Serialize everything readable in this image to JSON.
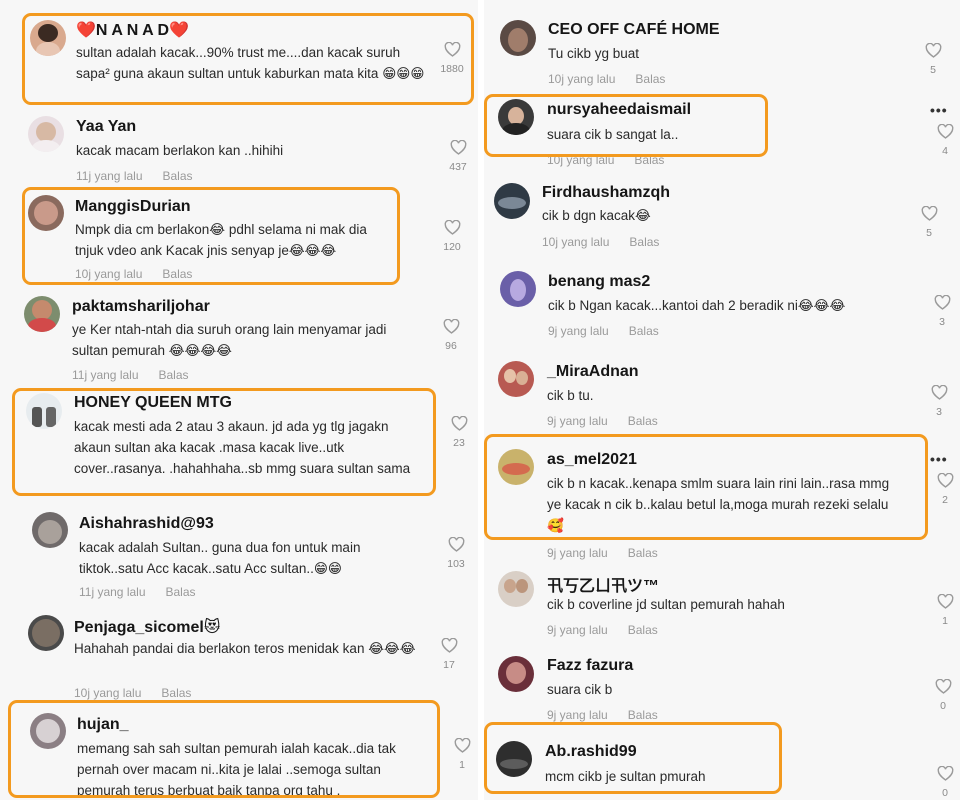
{
  "colors": {
    "highlight": "#f39a1f",
    "like_icon": "#9a9a9a"
  },
  "reply_label": "Balas",
  "more_label": "•••",
  "left_comments": [
    {
      "username": "❤️N A N A D❤️",
      "text": "sultan adalah kacak...90% trust me....dan kacak suruh sapa² guna akaun sultan untuk kaburkan mata kita 😁😁😁",
      "time": "",
      "likes": "1880",
      "highlighted": true
    },
    {
      "username": "Yaa Yan",
      "text": "kacak macam berlakon kan ..hihihi",
      "time": "11j yang lalu",
      "likes": "437",
      "highlighted": false
    },
    {
      "username": "ManggisDurian",
      "text": "Nmpk dia cm berlakon😂 pdhl selama ni mak dia tnjuk vdeo ank Kacak jnis senyap je😂😂😂",
      "time": "10j yang lalu",
      "likes": "120",
      "highlighted": true
    },
    {
      "username": "paktamshariljohar",
      "text": "ye Ker ntah-ntah dia suruh orang lain menyamar jadi sultan pemurah 😂😂😂😂",
      "time": "11j yang lalu",
      "likes": "96",
      "highlighted": false
    },
    {
      "username": "HONEY QUEEN MTG",
      "text": "kacak mesti ada 2 atau 3 akaun. jd ada yg tlg jagakn akaun sultan aka kacak .masa kacak live..utk cover..rasanya. .hahahhaha..sb mmg suara sultan sama",
      "time": "",
      "likes": "23",
      "highlighted": true
    },
    {
      "username": "Aishahrashid@93",
      "text": "kacak adalah Sultan.. guna dua fon untuk main tiktok..satu Acc kacak..satu Acc sultan..😁😁",
      "time": "11j yang lalu",
      "likes": "103",
      "highlighted": false
    },
    {
      "username": "Penjaga_sicomel😻",
      "text": "Hahahah pandai dia berlakon teros menidak kan 😂😂😂",
      "time": "10j yang lalu",
      "likes": "17",
      "highlighted": false
    },
    {
      "username": "hujan_",
      "text": "memang sah sah sultan pemurah ialah kacak..dia tak pernah over macam ni..kita je lalai ..semoga sultan pemurah terus berbuat baik tanpa org tahu .",
      "time": "",
      "likes": "1",
      "highlighted": true
    }
  ],
  "right_comments": [
    {
      "username": "CEO OFF CAFÉ HOME",
      "text": "Tu cikb yg buat",
      "time": "10j yang lalu",
      "likes": "5",
      "highlighted": false,
      "more": false
    },
    {
      "username": "nursyaheedaismail",
      "text": "suara cik b sangat la..",
      "time": "10j yang lalu",
      "likes": "4",
      "highlighted": true,
      "more": true
    },
    {
      "username": "Firdhaushamzqh",
      "text": "cik b dgn kacak😂",
      "time": "10j yang lalu",
      "likes": "5",
      "highlighted": false,
      "more": false
    },
    {
      "username": "benang mas2",
      "text": "cik b Ngan kacak...kantoi dah 2 beradik ni😂😂😂",
      "time": "9j yang lalu",
      "likes": "3",
      "highlighted": false,
      "more": false
    },
    {
      "username": "_MiraAdnan",
      "text": "cik b tu.",
      "time": "9j yang lalu",
      "likes": "3",
      "highlighted": false,
      "more": false
    },
    {
      "username": "as_mel2021",
      "text": "cik b n kacak..kenapa smlm suara lain rini lain..rasa mmg ye kacak n cik b..kalau betul la,moga murah rezeki selalu🥰",
      "time": "9j yang lalu",
      "likes": "2",
      "highlighted": true,
      "more": true
    },
    {
      "username": "卂丂乙ㄩ卂ツ™",
      "text": "cik b coverline jd sultan pemurah hahah",
      "time": "9j yang lalu",
      "likes": "1",
      "highlighted": false,
      "more": false
    },
    {
      "username": "Fazz fazura",
      "text": "suara cik b",
      "time": "9j yang lalu",
      "likes": "0",
      "highlighted": false,
      "more": false
    },
    {
      "username": "Ab.rashid99",
      "text": "mcm cikb je sultan pmurah",
      "time": "",
      "likes": "0",
      "highlighted": true,
      "more": false
    }
  ]
}
